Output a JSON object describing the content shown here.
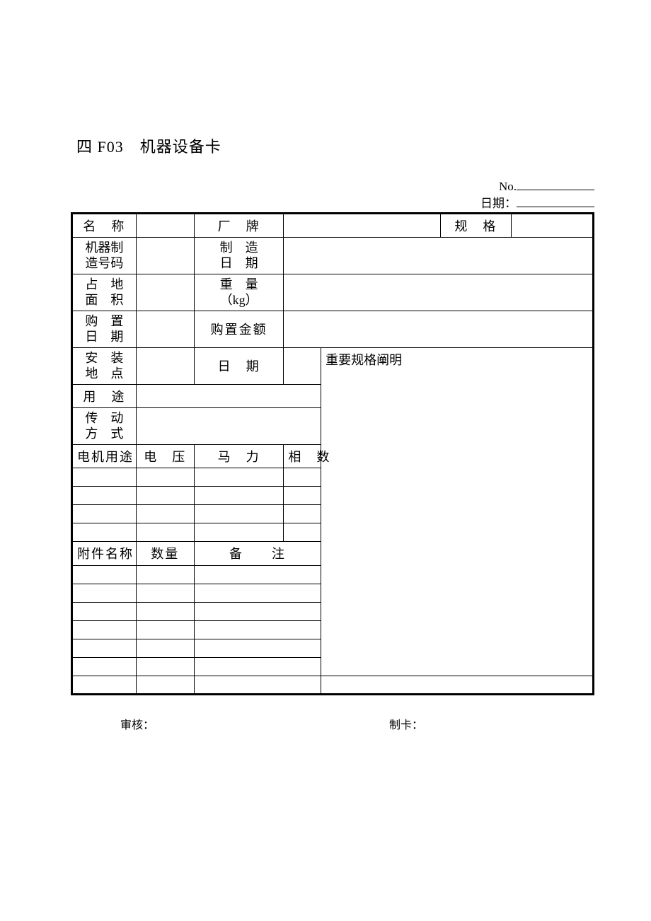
{
  "title": "四 F03　机器设备卡",
  "header": {
    "no_label": "No.",
    "date_label": "日期："
  },
  "labels": {
    "name": "名　称",
    "brand": "厂　牌",
    "spec": "规　格",
    "machine_no": "机器制\n造号码",
    "mfg_date": "制　造\n日　期",
    "area": "占　地\n面　积",
    "weight": "重　量\n（kg）",
    "purchase_date": "购　置\n日　期",
    "purchase_amount": "购置金额",
    "install_loc": "安　装\n地　点",
    "date": "日　期",
    "spec_desc": "重要规格阐明",
    "purpose": "用　途",
    "drive": "传　动\n方　式",
    "motor_purpose": "电机用途",
    "voltage": "电　压",
    "hp": "马　力",
    "phase": "相　数",
    "acc_name": "附件名称",
    "qty": "数量",
    "remark": "备　　注"
  },
  "footer": {
    "review": "审核：",
    "card": "制卡："
  }
}
